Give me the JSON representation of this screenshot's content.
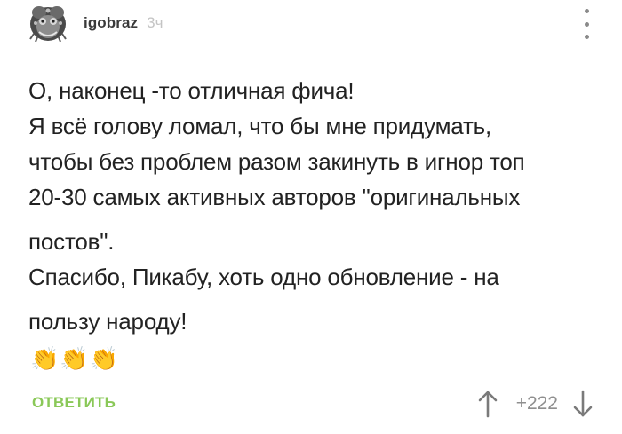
{
  "comment": {
    "author": "igobraz",
    "time": "3ч",
    "body_lines": [
      "О, наконец -то отличная фича!",
      "Я всё голову ломал, что бы мне придумать,",
      "чтобы без проблем разом закинуть в игнор топ",
      "20-30 самых активных авторов \"оригинальных",
      "постов\".",
      "Спасибо, Пикабу, хоть одно обновление - на",
      "пользу народу!"
    ],
    "emojis": "👏👏👏",
    "reply_label": "ОТВЕТИТЬ",
    "score": "+222"
  },
  "icons": {
    "avatar": "avatar-icon",
    "menu": "more-vertical-icon",
    "upvote": "arrow-up-icon",
    "downvote": "arrow-down-icon"
  },
  "colors": {
    "reply": "#8ac858",
    "time": "#c4c4c4",
    "score": "#8f8f8f",
    "arrows": "#7a7a7a"
  }
}
